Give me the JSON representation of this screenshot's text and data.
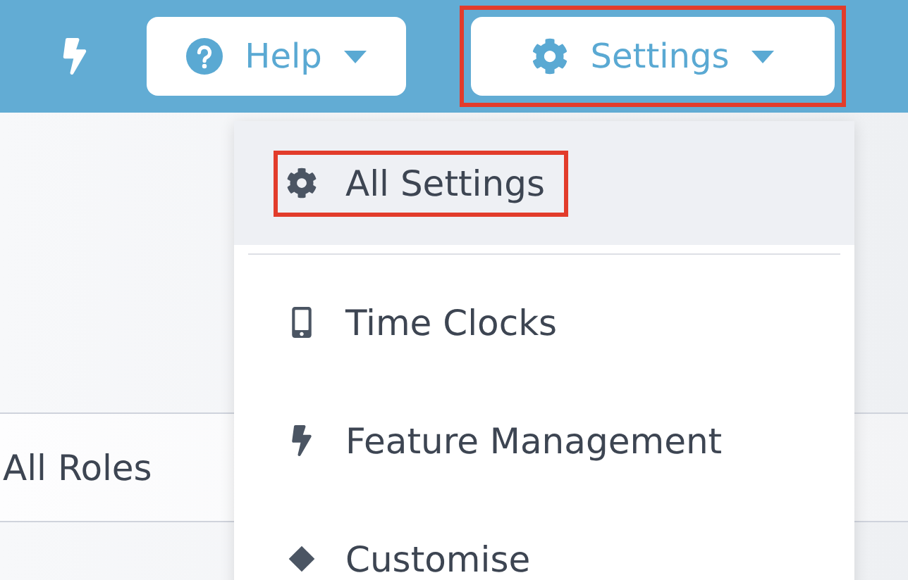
{
  "top_bar": {
    "buttons": [
      {
        "kind": "help",
        "label": "Help",
        "highlighted": false
      },
      {
        "kind": "gear",
        "label": "Settings",
        "highlighted": true
      }
    ]
  },
  "filter": {
    "value": "All Roles"
  },
  "menu": {
    "items": [
      {
        "kind": "gear",
        "label": "All Settings",
        "selected": true,
        "highlighted": true
      },
      {
        "kind": "divider"
      },
      {
        "kind": "phone",
        "label": "Time Clocks",
        "selected": false,
        "highlighted": false
      },
      {
        "kind": "bolt",
        "label": "Feature Management",
        "selected": false,
        "highlighted": false
      },
      {
        "kind": "diamond",
        "label": "Customise",
        "selected": false,
        "highlighted": false
      }
    ]
  }
}
